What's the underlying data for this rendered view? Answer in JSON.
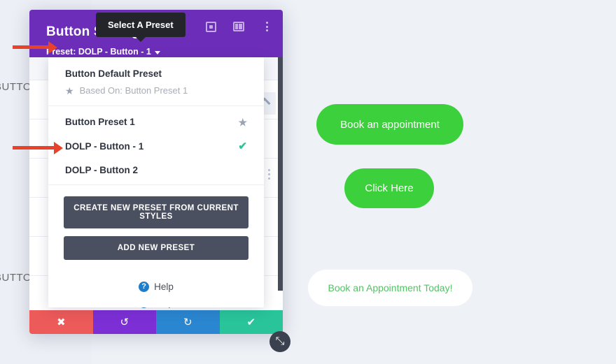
{
  "page": {
    "background_color": "#eef1f6",
    "left_strip_labels": [
      "BUTTON",
      "BUTTON"
    ]
  },
  "preview": {
    "buttons": [
      {
        "label": "Book an appointment",
        "style": "green",
        "bg": "#3cd13c",
        "color": "#ffffff"
      },
      {
        "label": "Click Here",
        "style": "green",
        "bg": "#3cd13c",
        "color": "#ffffff"
      },
      {
        "label": "Book an Appointment Today!",
        "style": "white",
        "bg": "#ffffff",
        "color": "#55c265"
      }
    ]
  },
  "modal": {
    "title": "Button Settings",
    "header_color": "#6c2eb9",
    "preset_label": "Preset: DOLP - Button - 1",
    "header_icons": [
      {
        "name": "focus-target-icon"
      },
      {
        "name": "layout-panel-icon"
      },
      {
        "name": "vertical-dots-icon"
      }
    ],
    "help_label": "Help",
    "help_badge": "?",
    "footer_buttons": [
      {
        "name": "cancel",
        "glyph": "✖",
        "color": "#ec5a5a"
      },
      {
        "name": "undo",
        "glyph": "↺",
        "color": "#7b2fd4"
      },
      {
        "name": "redo",
        "glyph": "↻",
        "color": "#2a86d0"
      },
      {
        "name": "save",
        "glyph": "✔",
        "color": "#29c49a"
      }
    ],
    "resize_handle_glyph": "⤡"
  },
  "tooltip": {
    "text": "Select A Preset",
    "background": "#23252b"
  },
  "dropdown": {
    "default_section": {
      "title": "Button Default Preset",
      "based_on": "Based On: Button Preset 1",
      "star_glyph": "★"
    },
    "items": [
      {
        "label": "Button Preset 1",
        "marker": "★",
        "marker_type": "star"
      },
      {
        "label": "DOLP - Button - 1",
        "marker": "✔",
        "marker_type": "check"
      },
      {
        "label": "DOLP - Button 2",
        "marker": "",
        "marker_type": "none"
      }
    ],
    "actions": [
      {
        "label": "CREATE NEW PRESET FROM CURRENT STYLES"
      },
      {
        "label": "ADD NEW PRESET"
      }
    ],
    "help_label": "Help",
    "help_badge": "?"
  },
  "annotations": {
    "arrow_color": "#e8432a",
    "arrows": [
      {
        "target": "preset-label"
      },
      {
        "target": "dolp-button-1-item"
      }
    ]
  }
}
